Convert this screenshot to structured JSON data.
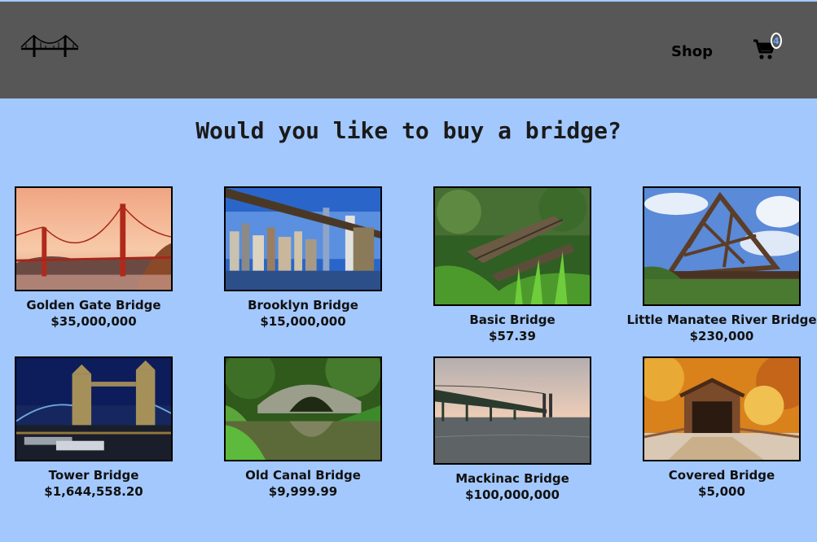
{
  "header": {
    "logo_icon": "bridge-logo-icon",
    "nav_shop": "Shop",
    "cart_icon": "shopping-cart-icon",
    "cart_count": "4"
  },
  "main": {
    "title": "Would you like to buy a bridge?"
  },
  "products": [
    {
      "name": "Golden Gate Bridge",
      "price": "$35,000,000"
    },
    {
      "name": "Brooklyn Bridge",
      "price": "$15,000,000"
    },
    {
      "name": "Basic Bridge",
      "price": "$57.39"
    },
    {
      "name": "Little Manatee River Bridge",
      "price": "$230,000"
    },
    {
      "name": "Tower Bridge",
      "price": "$1,644,558.20"
    },
    {
      "name": "Old Canal Bridge",
      "price": "$9,999.99"
    },
    {
      "name": "Mackinac Bridge",
      "price": "$100,000,000"
    },
    {
      "name": "Covered Bridge",
      "price": "$5,000"
    }
  ]
}
